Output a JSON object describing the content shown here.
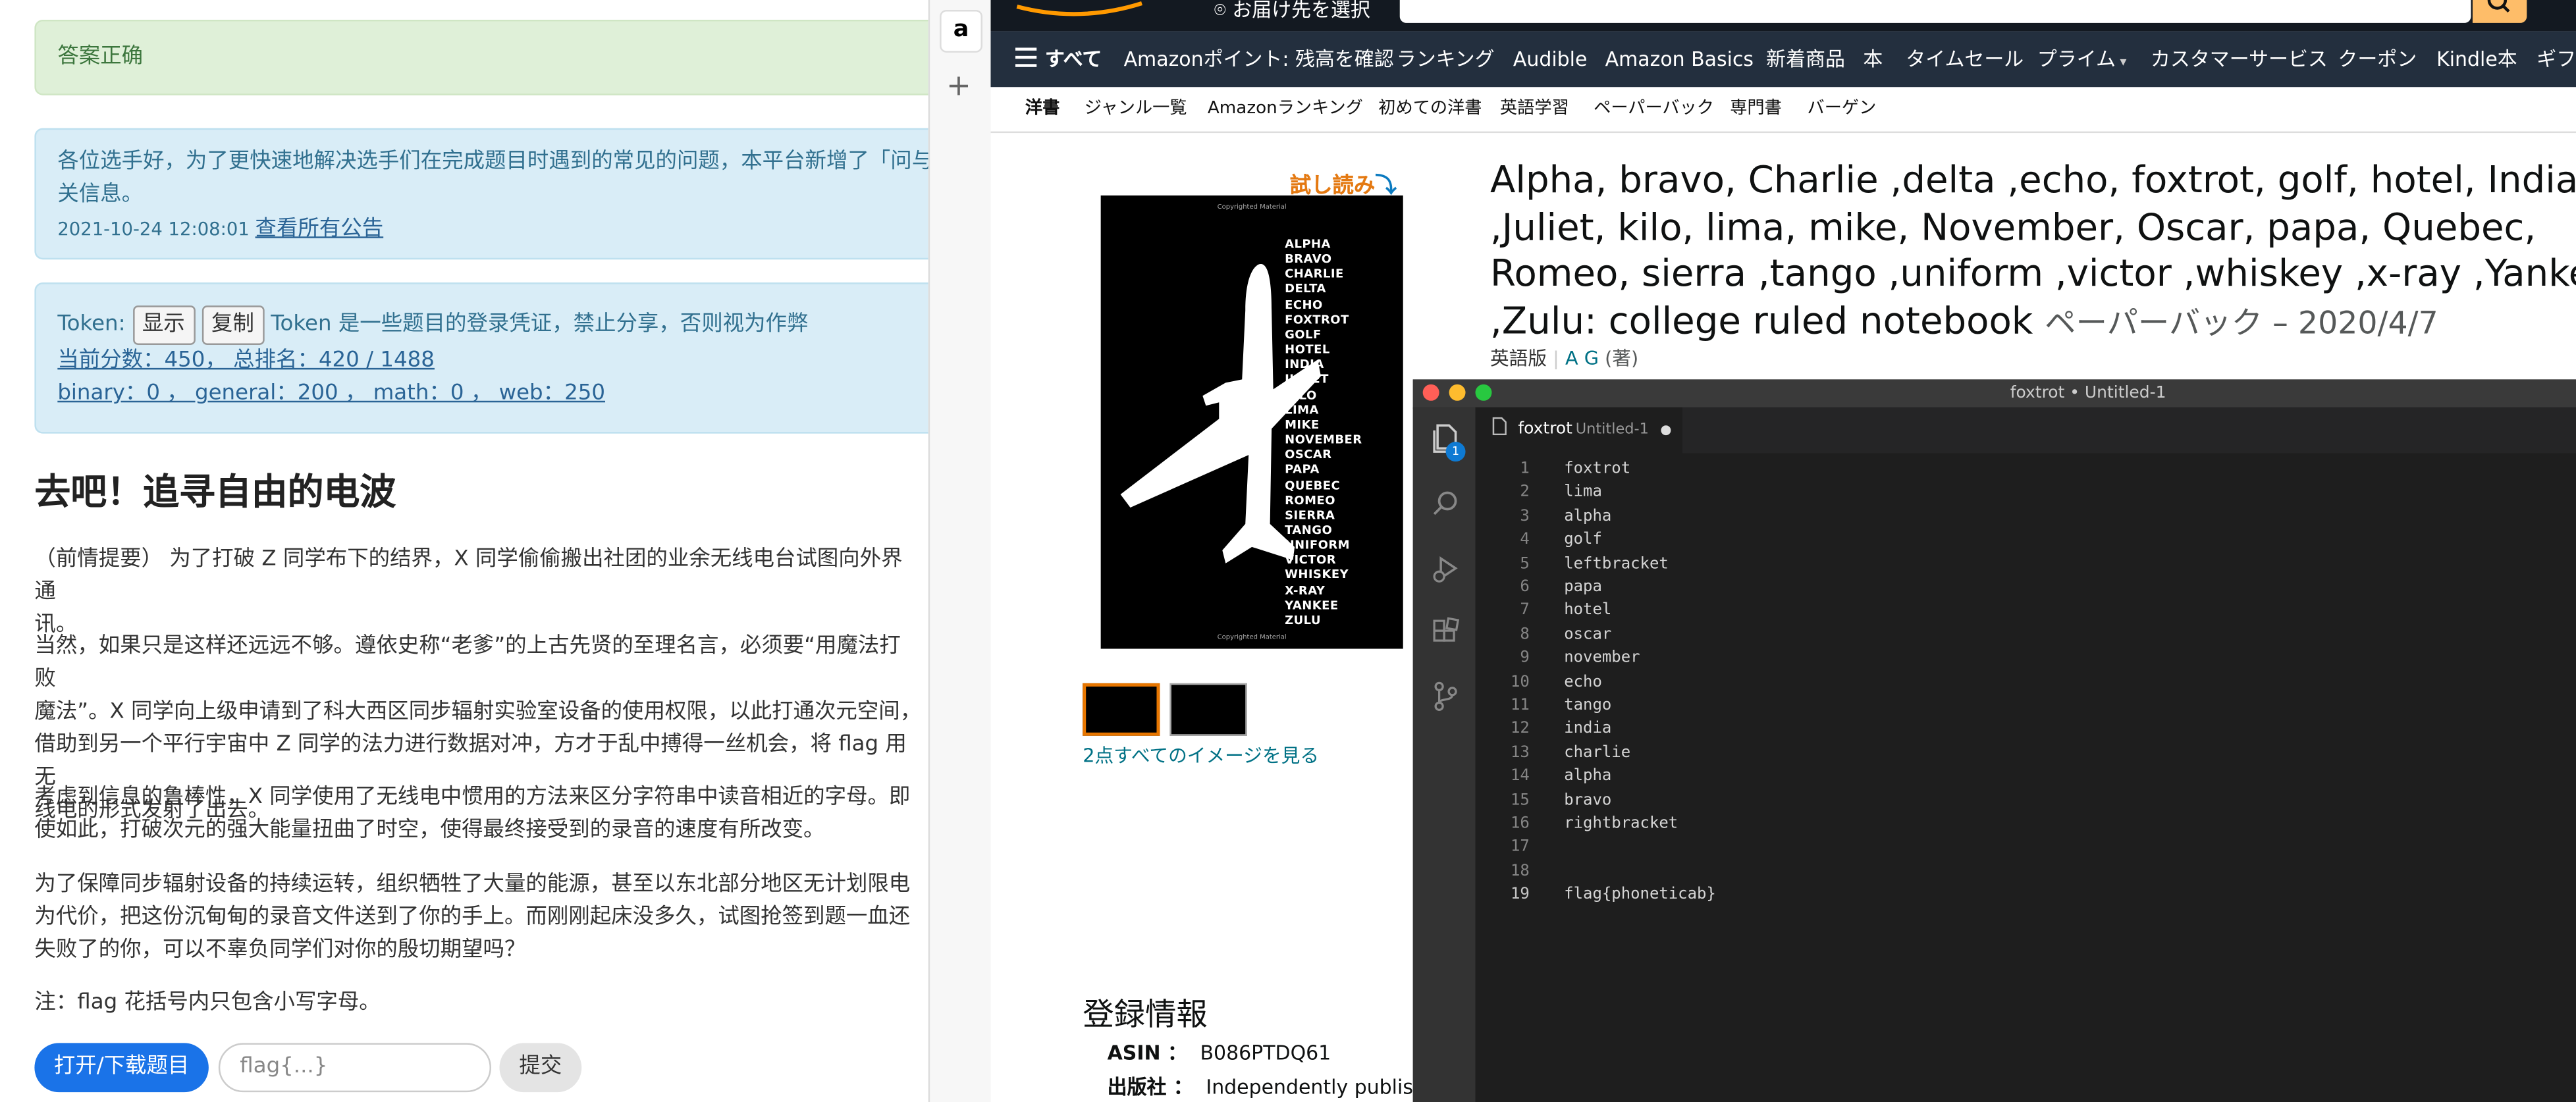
{
  "left": {
    "success": "答案正确",
    "notice": {
      "text1": "各位选手好，为了更快速地解决选手们在完成题目时遇到的常见的问题，本平台新增了「问与",
      "text2": "关信息。",
      "date": "2021-10-24 12:08:01",
      "link": "查看所有公告"
    },
    "token": {
      "label": "Token:",
      "show": "显示",
      "copy": "复制",
      "desc": "Token 是一些题目的登录凭证，禁止分享，否则视为作弊",
      "score": "当前分数：450， 总排名：420 / 1488",
      "categories": "binary：0 ， general：200 ， math：0 ， web：250"
    },
    "title": "去吧！追寻自由的电波",
    "paragraphs": [
      "（前情提要） 为了打破 Z 同学布下的结界，X 同学偷偷搬出社团的业余无线电台试图向外界通",
      "讯。",
      "当然，如果只是这样还远远不够。遵依史称“老爹”的上古先贤的至理名言，必须要“用魔法打败",
      "魔法”。X 同学向上级申请到了科大西区同步辐射实验室设备的使用权限，以此打通次元空间，",
      "借助到另一个平行宇宙中 Z 同学的法力进行数据对冲，方才于乱中搏得一丝机会，将 flag 用无",
      "线电的形式发射了出去。",
      "考虑到信息的鲁棒性，X 同学使用了无线电中惯用的方法来区分字符串中读音相近的字母。即",
      "使如此，打破次元的强大能量扭曲了时空，使得最终接受到的录音的速度有所改变。",
      "为了保障同步辐射设备的持续运转，组织牺牲了大量的能源，甚至以东北部分地区无计划限电",
      "为代价，把这份沉甸甸的录音文件送到了你的手上。而刚刚起床没多久，试图抢签到题一血还",
      "失败了的你，可以不辜负同学们对你的殷切期望吗？",
      "注：flag 花括号内只包含小写字母。"
    ],
    "download_button": "打开/下载题目",
    "flag_placeholder": "flag{...}",
    "submit_button": "提交"
  },
  "strip": {
    "amazon_tab": "a",
    "add": "+"
  },
  "amazon": {
    "deliver": "お届け先を選択",
    "nav": [
      "すべて",
      "Amazonポイント: 残高を確認",
      "ランキング",
      "Audible",
      "Amazon Basics",
      "新着商品",
      "本",
      "タイムセール",
      "プライム",
      "カスタマーサービス",
      "クーポン",
      "Kindle本",
      "ギフ"
    ],
    "subnav": [
      "洋書",
      "ジャンル一覧",
      "Amazonランキング",
      "初めての洋書",
      "英語学習",
      "ペーパーバック",
      "専門書",
      "バーゲン"
    ],
    "try_read_a": "試し読み",
    "try_read_b": "⤵",
    "cover_copyright": "Copyrighted Material",
    "cover_words": [
      "ALPHA",
      "BRAVO",
      "CHARLIE",
      "DELTA",
      "ECHO",
      "FOXTROT",
      "GOLF",
      "HOTEL",
      "INDIA",
      "JULIET",
      "KILO",
      "LIMA",
      "MIKE",
      "NOVEMBER",
      "OSCAR",
      "PAPA",
      "QUEBEC",
      "ROMEO",
      "SIERRA",
      "TANGO",
      "UNIFORM",
      "VICTOR",
      "WHISKEY",
      "X-RAY",
      "YANKEE",
      "ZULU"
    ],
    "all_images": "2点すべてのイメージを見る",
    "title_lines": [
      "Alpha, bravo, Charlie ,delta ,echo, foxtrot, golf, hotel, India",
      ",Juliet, kilo, lima, mike, November, Oscar, papa, Quebec,",
      "Romeo, sierra ,tango ,uniform ,victor ,whiskey ,x-ray ,Yankee",
      ",Zulu: college ruled notebook"
    ],
    "format": "ペーパーバック – 2020/4/7",
    "lang": "英語版",
    "author": "A G",
    "author_role": "(著)",
    "reg_title": "登録情報",
    "asin_label": "ASIN ：",
    "asin": "B086PTDQ61",
    "publisher_label": "出版社 ：",
    "publisher": "Independently published"
  },
  "editor": {
    "title": "foxtrot • Untitled-1",
    "tab_name": "foxtrot",
    "tab_sub": "Untitled-1",
    "badge": "1",
    "lines": [
      "foxtrot",
      "lima",
      "alpha",
      "golf",
      "leftbracket",
      "papa",
      "hotel",
      "oscar",
      "november",
      "echo",
      "tango",
      "india",
      "charlie",
      "alpha",
      "bravo",
      "rightbracket",
      "",
      "",
      "flag{phoneticab}"
    ],
    "line_numbers": [
      "1",
      "2",
      "3",
      "4",
      "5",
      "6",
      "7",
      "8",
      "9",
      "10",
      "11",
      "12",
      "13",
      "14",
      "15",
      "16",
      "17",
      "18",
      "19"
    ]
  }
}
